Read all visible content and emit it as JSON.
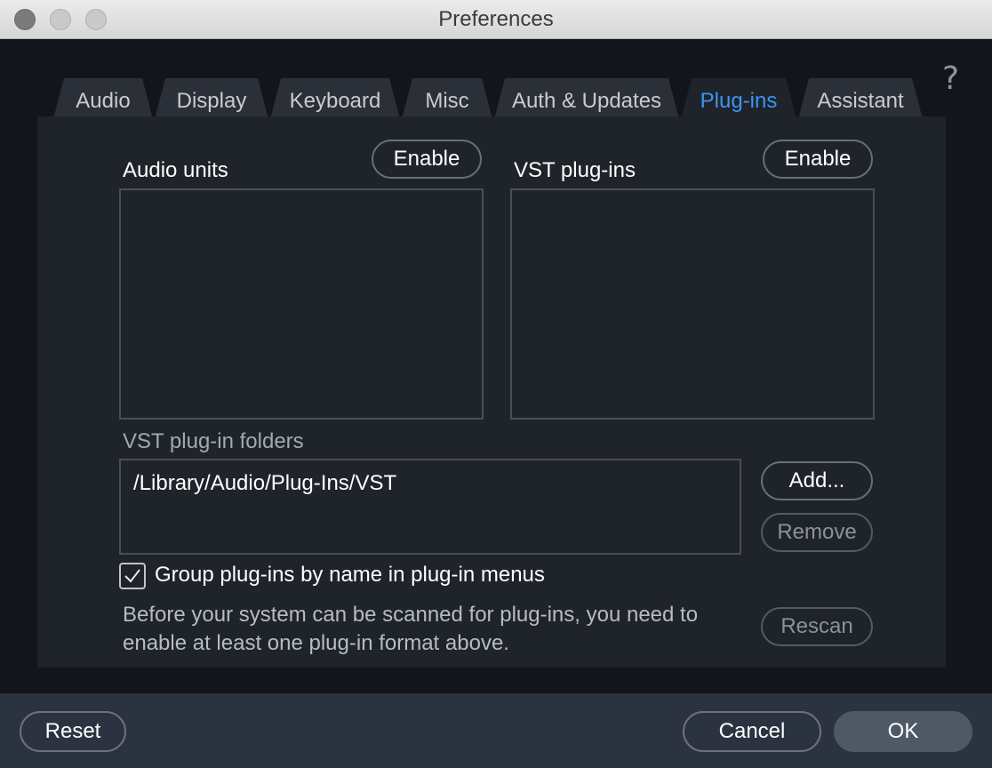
{
  "window": {
    "title": "Preferences"
  },
  "tabs": [
    {
      "label": "Audio"
    },
    {
      "label": "Display"
    },
    {
      "label": "Keyboard"
    },
    {
      "label": "Misc"
    },
    {
      "label": "Auth & Updates"
    },
    {
      "label": "Plug-ins",
      "active": true
    },
    {
      "label": "Assistant"
    }
  ],
  "help": {
    "glyph": "?"
  },
  "audio_units": {
    "label": "Audio units",
    "enable_label": "Enable"
  },
  "vst_plugins": {
    "label": "VST plug-ins",
    "enable_label": "Enable"
  },
  "vst_folders": {
    "label": "VST plug-in folders",
    "items": [
      "/Library/Audio/Plug-Ins/VST"
    ],
    "add_label": "Add...",
    "remove_label": "Remove"
  },
  "group_option": {
    "label": "Group plug-ins by name in plug-in menus",
    "checked": true
  },
  "scan_info": {
    "line1": "Before your system can be scanned for plug-ins, you need to",
    "line2": "enable at least one plug-in format above.",
    "rescan_label": "Rescan"
  },
  "footer": {
    "reset_label": "Reset",
    "cancel_label": "Cancel",
    "ok_label": "OK"
  },
  "colors": {
    "accent": "#3b95f2",
    "panel": "#1f232a",
    "footer": "#2c3340"
  }
}
